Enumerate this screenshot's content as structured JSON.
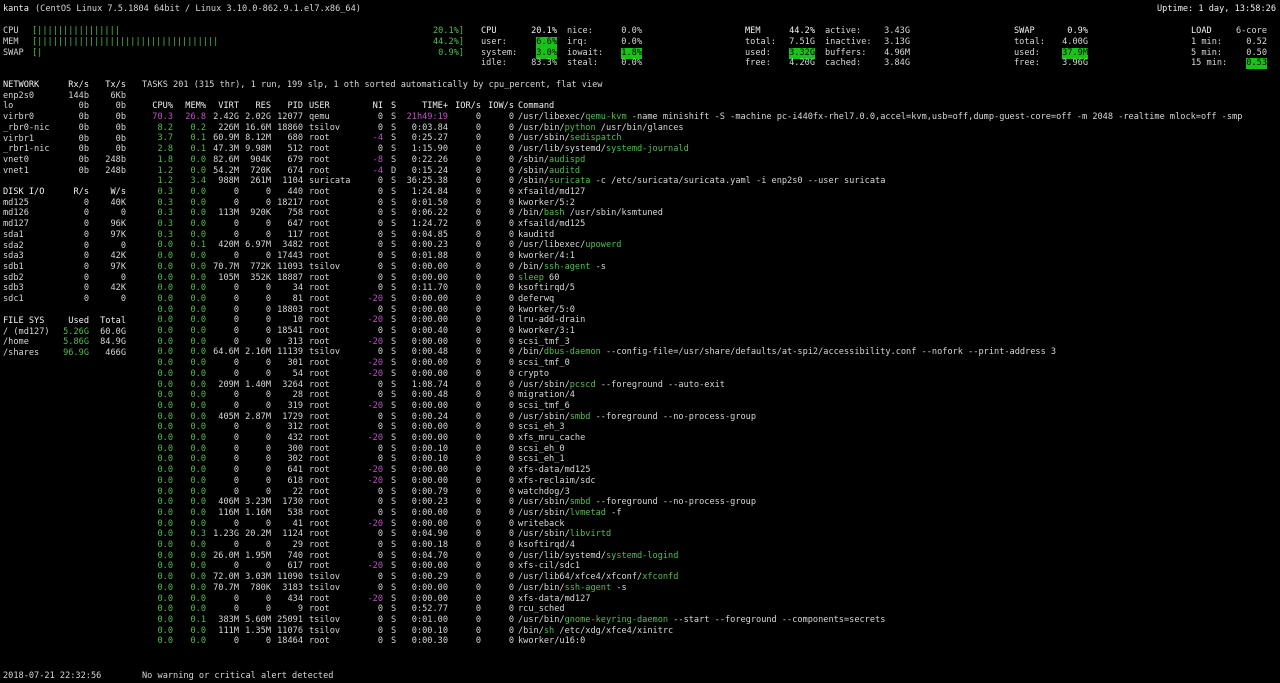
{
  "header": {
    "host": "kanta",
    "os": "(CentOS Linux 7.5.1804 64bit / Linux 3.10.0-862.9.1.el7.x86_64)",
    "uptime": "Uptime: 1 day, 13:58:26"
  },
  "quicklook": [
    {
      "label": "CPU",
      "bar": "[||||||||||||||||",
      "pct": "20.1%]",
      "fill_pct": 20.1
    },
    {
      "label": "MEM",
      "bar": "[|||||||||||||||||||||||||||||||||||",
      "pct": "44.2%]",
      "fill_pct": 44.2
    },
    {
      "label": "SWAP",
      "bar": "[|",
      "pct": "0.9%]",
      "fill_pct": 0.9
    }
  ],
  "cpu": {
    "title": "CPU",
    "total": "20.1%",
    "left": [
      {
        "k": "user:",
        "v": "6.6%",
        "hl": true
      },
      {
        "k": "system:",
        "v": "3.0%",
        "hl": true
      },
      {
        "k": "idle:",
        "v": "83.3%",
        "hl": false
      }
    ],
    "right": [
      {
        "k": "nice:",
        "v": "0.0%",
        "hl": false
      },
      {
        "k": "irq:",
        "v": "0.0%",
        "hl": false
      },
      {
        "k": "iowait:",
        "v": "1.8%",
        "hl": true
      },
      {
        "k": "steal:",
        "v": "0.0%",
        "hl": false
      }
    ]
  },
  "mem": {
    "title": "MEM",
    "total": "44.2%",
    "left": [
      {
        "k": "total:",
        "v": "7.51G",
        "hl": false
      },
      {
        "k": "used:",
        "v": "3.32G",
        "hl": true
      },
      {
        "k": "free:",
        "v": "4.20G",
        "hl": false
      }
    ],
    "right": [
      {
        "k": "active:",
        "v": "3.43G"
      },
      {
        "k": "inactive:",
        "v": "3.13G"
      },
      {
        "k": "buffers:",
        "v": "4.96M"
      },
      {
        "k": "cached:",
        "v": "3.84G"
      }
    ]
  },
  "swap": {
    "title": "SWAP",
    "total": "0.9%",
    "rows": [
      {
        "k": "total:",
        "v": "4.00G",
        "hl": false
      },
      {
        "k": "used:",
        "v": "37.9M",
        "hl": true
      },
      {
        "k": "free:",
        "v": "3.96G",
        "hl": false
      }
    ]
  },
  "load": {
    "title": "LOAD",
    "cores": "6-core",
    "rows": [
      {
        "k": "1 min:",
        "v": "0.52",
        "hl": false
      },
      {
        "k": "5 min:",
        "v": "0.50",
        "hl": false
      },
      {
        "k": "15 min:",
        "v": "0.53",
        "hl": true
      }
    ]
  },
  "network": {
    "headers": [
      "NETWORK",
      "Rx/s",
      "Tx/s"
    ],
    "rows": [
      [
        "enp2s0",
        "144b",
        "6Kb"
      ],
      [
        "lo",
        "0b",
        "0b"
      ],
      [
        "virbr0",
        "0b",
        "0b"
      ],
      [
        "_rbr0-nic",
        "0b",
        "0b"
      ],
      [
        "virbr1",
        "0b",
        "0b"
      ],
      [
        "_rbr1-nic",
        "0b",
        "0b"
      ],
      [
        "vnet0",
        "0b",
        "248b"
      ],
      [
        "vnet1",
        "0b",
        "248b"
      ]
    ]
  },
  "diskio": {
    "headers": [
      "DISK I/O",
      "R/s",
      "W/s"
    ],
    "rows": [
      [
        "md125",
        "0",
        "40K"
      ],
      [
        "md126",
        "0",
        "0"
      ],
      [
        "md127",
        "0",
        "96K"
      ],
      [
        "sda1",
        "0",
        "97K"
      ],
      [
        "sda2",
        "0",
        "0"
      ],
      [
        "sda3",
        "0",
        "42K"
      ],
      [
        "sdb1",
        "0",
        "97K"
      ],
      [
        "sdb2",
        "0",
        "0"
      ],
      [
        "sdb3",
        "0",
        "42K"
      ],
      [
        "sdc1",
        "0",
        "0"
      ]
    ]
  },
  "fs": {
    "headers": [
      "FILE SYS",
      "Used",
      "Total"
    ],
    "rows": [
      [
        "/ (md127)",
        "5.26G",
        "60.0G"
      ],
      [
        "/home",
        "5.86G",
        "84.9G"
      ],
      [
        "/shares",
        "96.9G",
        "466G"
      ]
    ]
  },
  "tasks": {
    "summary": "TASKS 201 (315 thr), 1 run, 199 slp, 1 oth sorted automatically by cpu_percent, flat view",
    "headers": [
      "CPU%",
      "MEM%",
      "VIRT",
      "RES",
      "PID",
      "USER",
      "NI",
      "S",
      "TIME+",
      "IOR/s",
      "IOW/s",
      "Command"
    ],
    "rows": [
      [
        "70.3",
        "26.8",
        "2.42G",
        "2.02G",
        "12077",
        "qemu",
        "0",
        "S",
        "21h49:19",
        "0",
        "0",
        "/usr/libexec/",
        "qemu-kvm",
        " -name minishift -S -machine pc-i440fx-rhel7.0.0,accel=kvm,usb=off,dump-guest-core=off -m 2048 -realtime mlock=off -smp"
      ],
      [
        "8.2",
        "0.2",
        "226M",
        "16.6M",
        "18860",
        "tsilov",
        "0",
        "S",
        "0:03.84",
        "0",
        "0",
        "/usr/bin/",
        "python",
        " /usr/bin/glances"
      ],
      [
        "3.7",
        "0.1",
        "60.9M",
        "8.12M",
        "680",
        "root",
        "-4",
        "S",
        "0:25.27",
        "0",
        "0",
        "/usr/sbin/",
        "sedispatch",
        ""
      ],
      [
        "2.8",
        "0.1",
        "47.3M",
        "9.98M",
        "512",
        "root",
        "0",
        "S",
        "1:15.90",
        "0",
        "0",
        "/usr/lib/systemd/",
        "systemd-journald",
        ""
      ],
      [
        "1.8",
        "0.0",
        "82.6M",
        "904K",
        "679",
        "root",
        "-8",
        "S",
        "0:22.26",
        "0",
        "0",
        "/sbin/",
        "audispd",
        ""
      ],
      [
        "1.2",
        "0.0",
        "54.2M",
        "720K",
        "674",
        "root",
        "-4",
        "D",
        "0:15.24",
        "0",
        "0",
        "/sbin/",
        "auditd",
        ""
      ],
      [
        "1.2",
        "3.4",
        "988M",
        "261M",
        "1104",
        "suricata",
        "0",
        "S",
        "36:25.38",
        "0",
        "0",
        "/sbin/",
        "suricata",
        " -c /etc/suricata/suricata.yaml -i enp2s0 --user suricata"
      ],
      [
        "0.3",
        "0.0",
        "0",
        "0",
        "440",
        "root",
        "0",
        "S",
        "1:24.84",
        "0",
        "0",
        "",
        "",
        "xfsaild/md127"
      ],
      [
        "0.3",
        "0.0",
        "0",
        "0",
        "18217",
        "root",
        "0",
        "S",
        "0:01.50",
        "0",
        "0",
        "",
        "",
        "kworker/5:2"
      ],
      [
        "0.3",
        "0.0",
        "113M",
        "920K",
        "758",
        "root",
        "0",
        "S",
        "0:06.22",
        "0",
        "0",
        "/bin/",
        "bash",
        " /usr/sbin/ksmtuned"
      ],
      [
        "0.3",
        "0.0",
        "0",
        "0",
        "647",
        "root",
        "0",
        "S",
        "1:24.72",
        "0",
        "0",
        "",
        "",
        "xfsaild/md125"
      ],
      [
        "0.3",
        "0.0",
        "0",
        "0",
        "117",
        "root",
        "0",
        "S",
        "0:04.85",
        "0",
        "0",
        "",
        "",
        "kauditd"
      ],
      [
        "0.0",
        "0.1",
        "420M",
        "6.97M",
        "3482",
        "root",
        "0",
        "S",
        "0:00.23",
        "0",
        "0",
        "/usr/libexec/",
        "upowerd",
        ""
      ],
      [
        "0.0",
        "0.0",
        "0",
        "0",
        "17443",
        "root",
        "0",
        "S",
        "0:01.88",
        "0",
        "0",
        "",
        "",
        "kworker/4:1"
      ],
      [
        "0.0",
        "0.0",
        "70.7M",
        "772K",
        "11093",
        "tsilov",
        "0",
        "S",
        "0:00.00",
        "0",
        "0",
        "/bin/",
        "ssh-agent",
        " -s"
      ],
      [
        "0.0",
        "0.0",
        "105M",
        "352K",
        "18887",
        "root",
        "0",
        "S",
        "0:00.00",
        "0",
        "0",
        "",
        "sleep",
        " 60"
      ],
      [
        "0.0",
        "0.0",
        "0",
        "0",
        "34",
        "root",
        "0",
        "S",
        "0:11.70",
        "0",
        "0",
        "",
        "",
        "ksoftirqd/5"
      ],
      [
        "0.0",
        "0.0",
        "0",
        "0",
        "81",
        "root",
        "-20",
        "S",
        "0:00.00",
        "0",
        "0",
        "",
        "",
        "deferwq"
      ],
      [
        "0.0",
        "0.0",
        "0",
        "0",
        "18803",
        "root",
        "0",
        "S",
        "0:00.00",
        "0",
        "0",
        "",
        "",
        "kworker/5:0"
      ],
      [
        "0.0",
        "0.0",
        "0",
        "0",
        "10",
        "root",
        "-20",
        "S",
        "0:00.00",
        "0",
        "0",
        "",
        "",
        "lru-add-drain"
      ],
      [
        "0.0",
        "0.0",
        "0",
        "0",
        "18541",
        "root",
        "0",
        "S",
        "0:00.40",
        "0",
        "0",
        "",
        "",
        "kworker/3:1"
      ],
      [
        "0.0",
        "0.0",
        "0",
        "0",
        "313",
        "root",
        "-20",
        "S",
        "0:00.00",
        "0",
        "0",
        "",
        "",
        "scsi_tmf_3"
      ],
      [
        "0.0",
        "0.0",
        "64.6M",
        "2.16M",
        "11139",
        "tsilov",
        "0",
        "S",
        "0:00.48",
        "0",
        "0",
        "/bin/",
        "dbus-daemon",
        " --config-file=/usr/share/defaults/at-spi2/accessibility.conf --nofork --print-address 3"
      ],
      [
        "0.0",
        "0.0",
        "0",
        "0",
        "301",
        "root",
        "-20",
        "S",
        "0:00.00",
        "0",
        "0",
        "",
        "",
        "scsi_tmf_0"
      ],
      [
        "0.0",
        "0.0",
        "0",
        "0",
        "54",
        "root",
        "-20",
        "S",
        "0:00.00",
        "0",
        "0",
        "",
        "",
        "crypto"
      ],
      [
        "0.0",
        "0.0",
        "209M",
        "1.40M",
        "3264",
        "root",
        "0",
        "S",
        "1:08.74",
        "0",
        "0",
        "/usr/sbin/",
        "pcscd",
        " --foreground --auto-exit"
      ],
      [
        "0.0",
        "0.0",
        "0",
        "0",
        "28",
        "root",
        "0",
        "S",
        "0:00.48",
        "0",
        "0",
        "",
        "",
        "migration/4"
      ],
      [
        "0.0",
        "0.0",
        "0",
        "0",
        "319",
        "root",
        "-20",
        "S",
        "0:00.00",
        "0",
        "0",
        "",
        "",
        "scsi_tmf_6"
      ],
      [
        "0.0",
        "0.0",
        "405M",
        "2.87M",
        "1729",
        "root",
        "0",
        "S",
        "0:00.24",
        "0",
        "0",
        "/usr/sbin/",
        "smbd",
        " --foreground --no-process-group"
      ],
      [
        "0.0",
        "0.0",
        "0",
        "0",
        "312",
        "root",
        "0",
        "S",
        "0:00.00",
        "0",
        "0",
        "",
        "",
        "scsi_eh_3"
      ],
      [
        "0.0",
        "0.0",
        "0",
        "0",
        "432",
        "root",
        "-20",
        "S",
        "0:00.00",
        "0",
        "0",
        "",
        "",
        "xfs_mru_cache"
      ],
      [
        "0.0",
        "0.0",
        "0",
        "0",
        "300",
        "root",
        "0",
        "S",
        "0:00.10",
        "0",
        "0",
        "",
        "",
        "scsi_eh_0"
      ],
      [
        "0.0",
        "0.0",
        "0",
        "0",
        "302",
        "root",
        "0",
        "S",
        "0:00.10",
        "0",
        "0",
        "",
        "",
        "scsi_eh_1"
      ],
      [
        "0.0",
        "0.0",
        "0",
        "0",
        "641",
        "root",
        "-20",
        "S",
        "0:00.00",
        "0",
        "0",
        "",
        "",
        "xfs-data/md125"
      ],
      [
        "0.0",
        "0.0",
        "0",
        "0",
        "618",
        "root",
        "-20",
        "S",
        "0:00.00",
        "0",
        "0",
        "",
        "",
        "xfs-reclaim/sdc"
      ],
      [
        "0.0",
        "0.0",
        "0",
        "0",
        "22",
        "root",
        "0",
        "S",
        "0:00.79",
        "0",
        "0",
        "",
        "",
        "watchdog/3"
      ],
      [
        "0.0",
        "0.0",
        "406M",
        "3.23M",
        "1730",
        "root",
        "0",
        "S",
        "0:00.23",
        "0",
        "0",
        "/usr/sbin/",
        "smbd",
        " --foreground --no-process-group"
      ],
      [
        "0.0",
        "0.0",
        "116M",
        "1.16M",
        "538",
        "root",
        "0",
        "S",
        "0:00.00",
        "0",
        "0",
        "/usr/sbin/",
        "lvmetad",
        " -f"
      ],
      [
        "0.0",
        "0.0",
        "0",
        "0",
        "41",
        "root",
        "-20",
        "S",
        "0:00.00",
        "0",
        "0",
        "",
        "",
        "writeback"
      ],
      [
        "0.0",
        "0.3",
        "1.23G",
        "20.2M",
        "1124",
        "root",
        "0",
        "S",
        "0:04.90",
        "0",
        "0",
        "/usr/sbin/",
        "libvirtd",
        ""
      ],
      [
        "0.0",
        "0.0",
        "0",
        "0",
        "29",
        "root",
        "0",
        "S",
        "0:00.18",
        "0",
        "0",
        "",
        "",
        "ksoftirqd/4"
      ],
      [
        "0.0",
        "0.0",
        "26.0M",
        "1.95M",
        "740",
        "root",
        "0",
        "S",
        "0:04.70",
        "0",
        "0",
        "/usr/lib/systemd/",
        "systemd-logind",
        ""
      ],
      [
        "0.0",
        "0.0",
        "0",
        "0",
        "617",
        "root",
        "-20",
        "S",
        "0:00.00",
        "0",
        "0",
        "",
        "",
        "xfs-cil/sdc1"
      ],
      [
        "0.0",
        "0.0",
        "72.0M",
        "3.03M",
        "11090",
        "tsilov",
        "0",
        "S",
        "0:00.29",
        "0",
        "0",
        "/usr/lib64/xfce4/xfconf/",
        "xfconfd",
        ""
      ],
      [
        "0.0",
        "0.0",
        "70.7M",
        "780K",
        "3183",
        "tsilov",
        "0",
        "S",
        "0:00.00",
        "0",
        "0",
        "/usr/bin/",
        "ssh-agent",
        " -s"
      ],
      [
        "0.0",
        "0.0",
        "0",
        "0",
        "434",
        "root",
        "-20",
        "S",
        "0:00.00",
        "0",
        "0",
        "",
        "",
        "xfs-data/md127"
      ],
      [
        "0.0",
        "0.0",
        "0",
        "0",
        "9",
        "root",
        "0",
        "S",
        "0:52.77",
        "0",
        "0",
        "",
        "",
        "rcu_sched"
      ],
      [
        "0.0",
        "0.1",
        "383M",
        "5.60M",
        "25091",
        "tsilov",
        "0",
        "S",
        "0:01.00",
        "0",
        "0",
        "/usr/bin/",
        "gnome-keyring-daemon",
        " --start --foreground --components=secrets"
      ],
      [
        "0.0",
        "0.0",
        "111M",
        "1.35M",
        "11076",
        "tsilov",
        "0",
        "S",
        "0:00.10",
        "0",
        "0",
        "/bin/",
        "sh",
        " /etc/xdg/xfce4/xinitrc"
      ],
      [
        "0.0",
        "0.0",
        "0",
        "0",
        "18464",
        "root",
        "0",
        "S",
        "0:00.30",
        "0",
        "0",
        "",
        "",
        "kworker/u16:0"
      ]
    ]
  },
  "footer": {
    "datetime": "2018-07-21 22:32:56",
    "alert": "No warning or critical alert detected"
  }
}
